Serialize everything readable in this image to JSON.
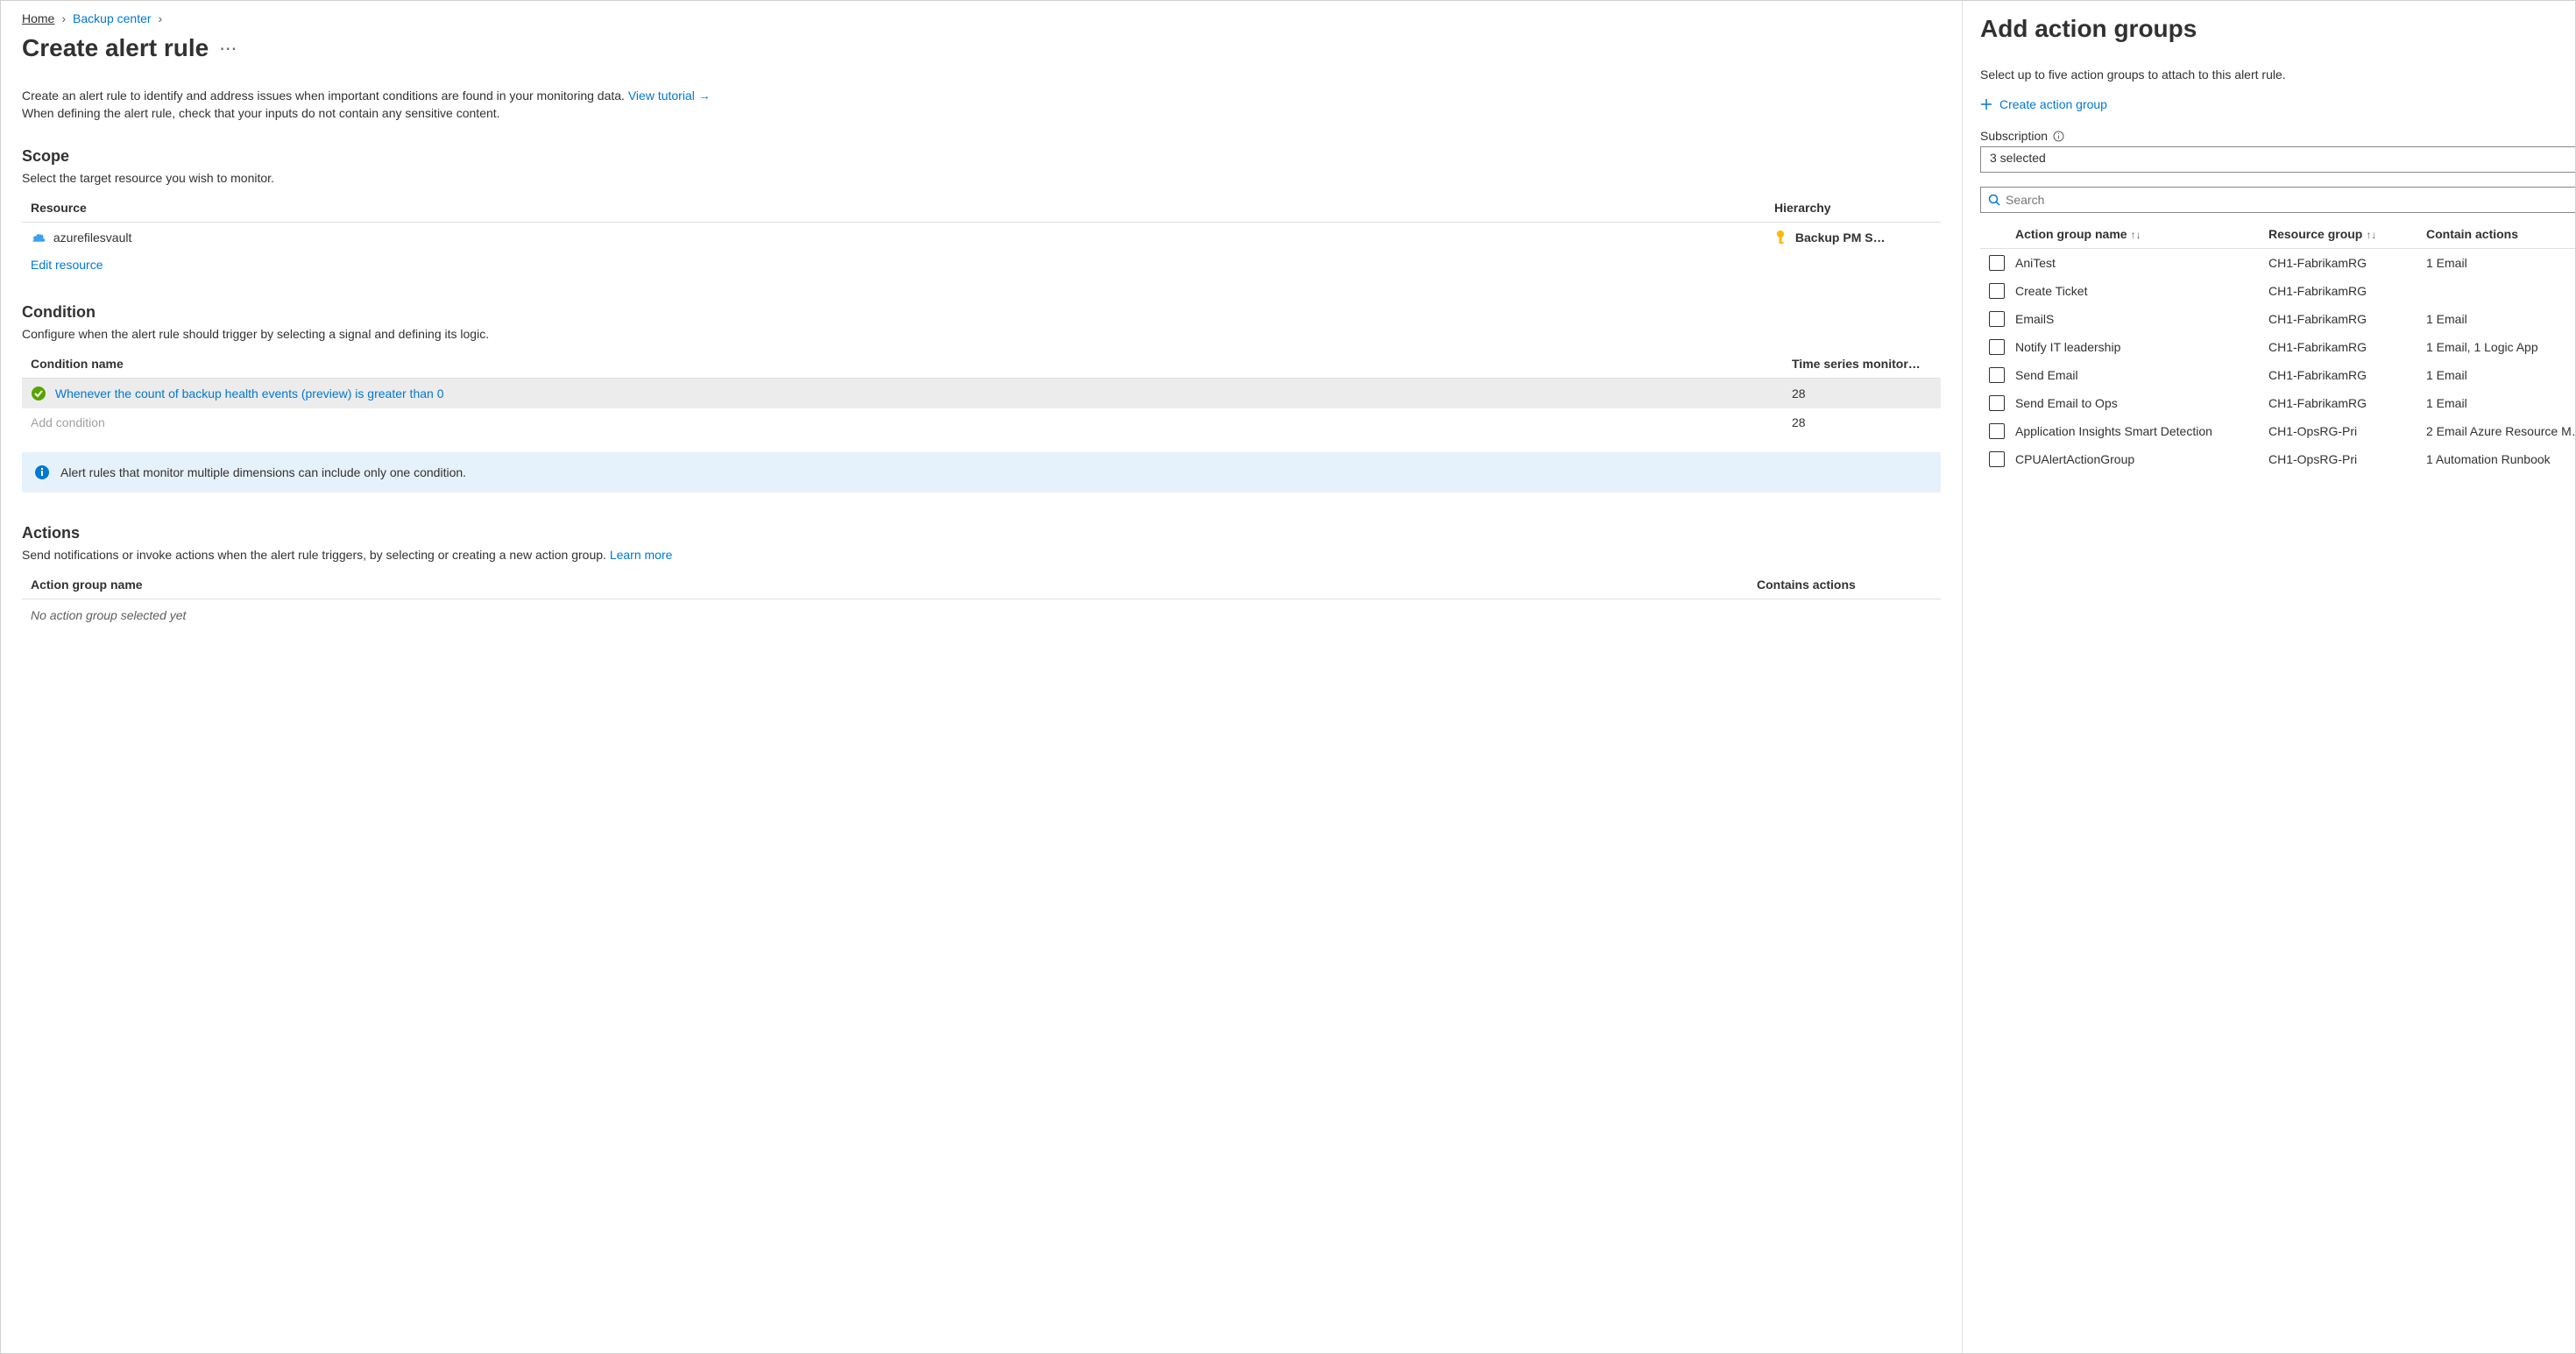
{
  "breadcrumb": {
    "home": "Home",
    "backup_center": "Backup center"
  },
  "page_title": "Create alert rule",
  "intro_text": "Create an alert rule to identify and address issues when important conditions are found in your monitoring data. ",
  "intro_link": "View tutorial →",
  "intro_text2": "When defining the alert rule, check that your inputs do not contain any sensitive content.",
  "scope": {
    "heading": "Scope",
    "desc": "Select the target resource you wish to monitor.",
    "col_resource": "Resource",
    "col_hierarchy": "Hierarchy",
    "resource_name": "azurefilesvault",
    "hierarchy_value": "Backup PM S…",
    "edit_link": "Edit resource"
  },
  "condition": {
    "heading": "Condition",
    "desc": "Configure when the alert rule should trigger by selecting a signal and defining its logic.",
    "col_name": "Condition name",
    "col_ts": "Time series monitor…",
    "row1_name": "Whenever the count of backup health events (preview) is greater than 0",
    "row1_ts": "28",
    "add_placeholder": "Add condition",
    "row2_ts": "28",
    "banner": "Alert rules that monitor multiple dimensions can include only one condition."
  },
  "actions": {
    "heading": "Actions",
    "desc": "Send notifications or invoke actions when the alert rule triggers, by selecting or creating a new action group. ",
    "learn_more": "Learn more",
    "col_name": "Action group name",
    "col_contains": "Contains actions",
    "empty": "No action group selected yet"
  },
  "panel": {
    "title": "Add action groups",
    "desc": "Select up to five action groups to attach to this alert rule.",
    "create_link": "Create action group",
    "subscription_label": "Subscription",
    "subscription_value": "3 selected",
    "search_placeholder": "Search",
    "col_name": "Action group name",
    "col_rg": "Resource group",
    "col_actions": "Contain actions",
    "rows": [
      {
        "name": "AniTest",
        "rg": "CH1-FabrikamRG",
        "actions": "1 Email"
      },
      {
        "name": "Create Ticket",
        "rg": "CH1-FabrikamRG",
        "actions": ""
      },
      {
        "name": "EmailS",
        "rg": "CH1-FabrikamRG",
        "actions": "1 Email"
      },
      {
        "name": "Notify IT leadership",
        "rg": "CH1-FabrikamRG",
        "actions": "1 Email, 1 Logic App"
      },
      {
        "name": "Send Email",
        "rg": "CH1-FabrikamRG",
        "actions": "1 Email"
      },
      {
        "name": "Send Email to Ops",
        "rg": "CH1-FabrikamRG",
        "actions": "1 Email"
      },
      {
        "name": "Application Insights Smart Detection",
        "rg": "CH1-OpsRG-Pri",
        "actions": "2 Email Azure Resource M…"
      },
      {
        "name": "CPUAlertActionGroup",
        "rg": "CH1-OpsRG-Pri",
        "actions": "1 Automation Runbook"
      }
    ]
  }
}
